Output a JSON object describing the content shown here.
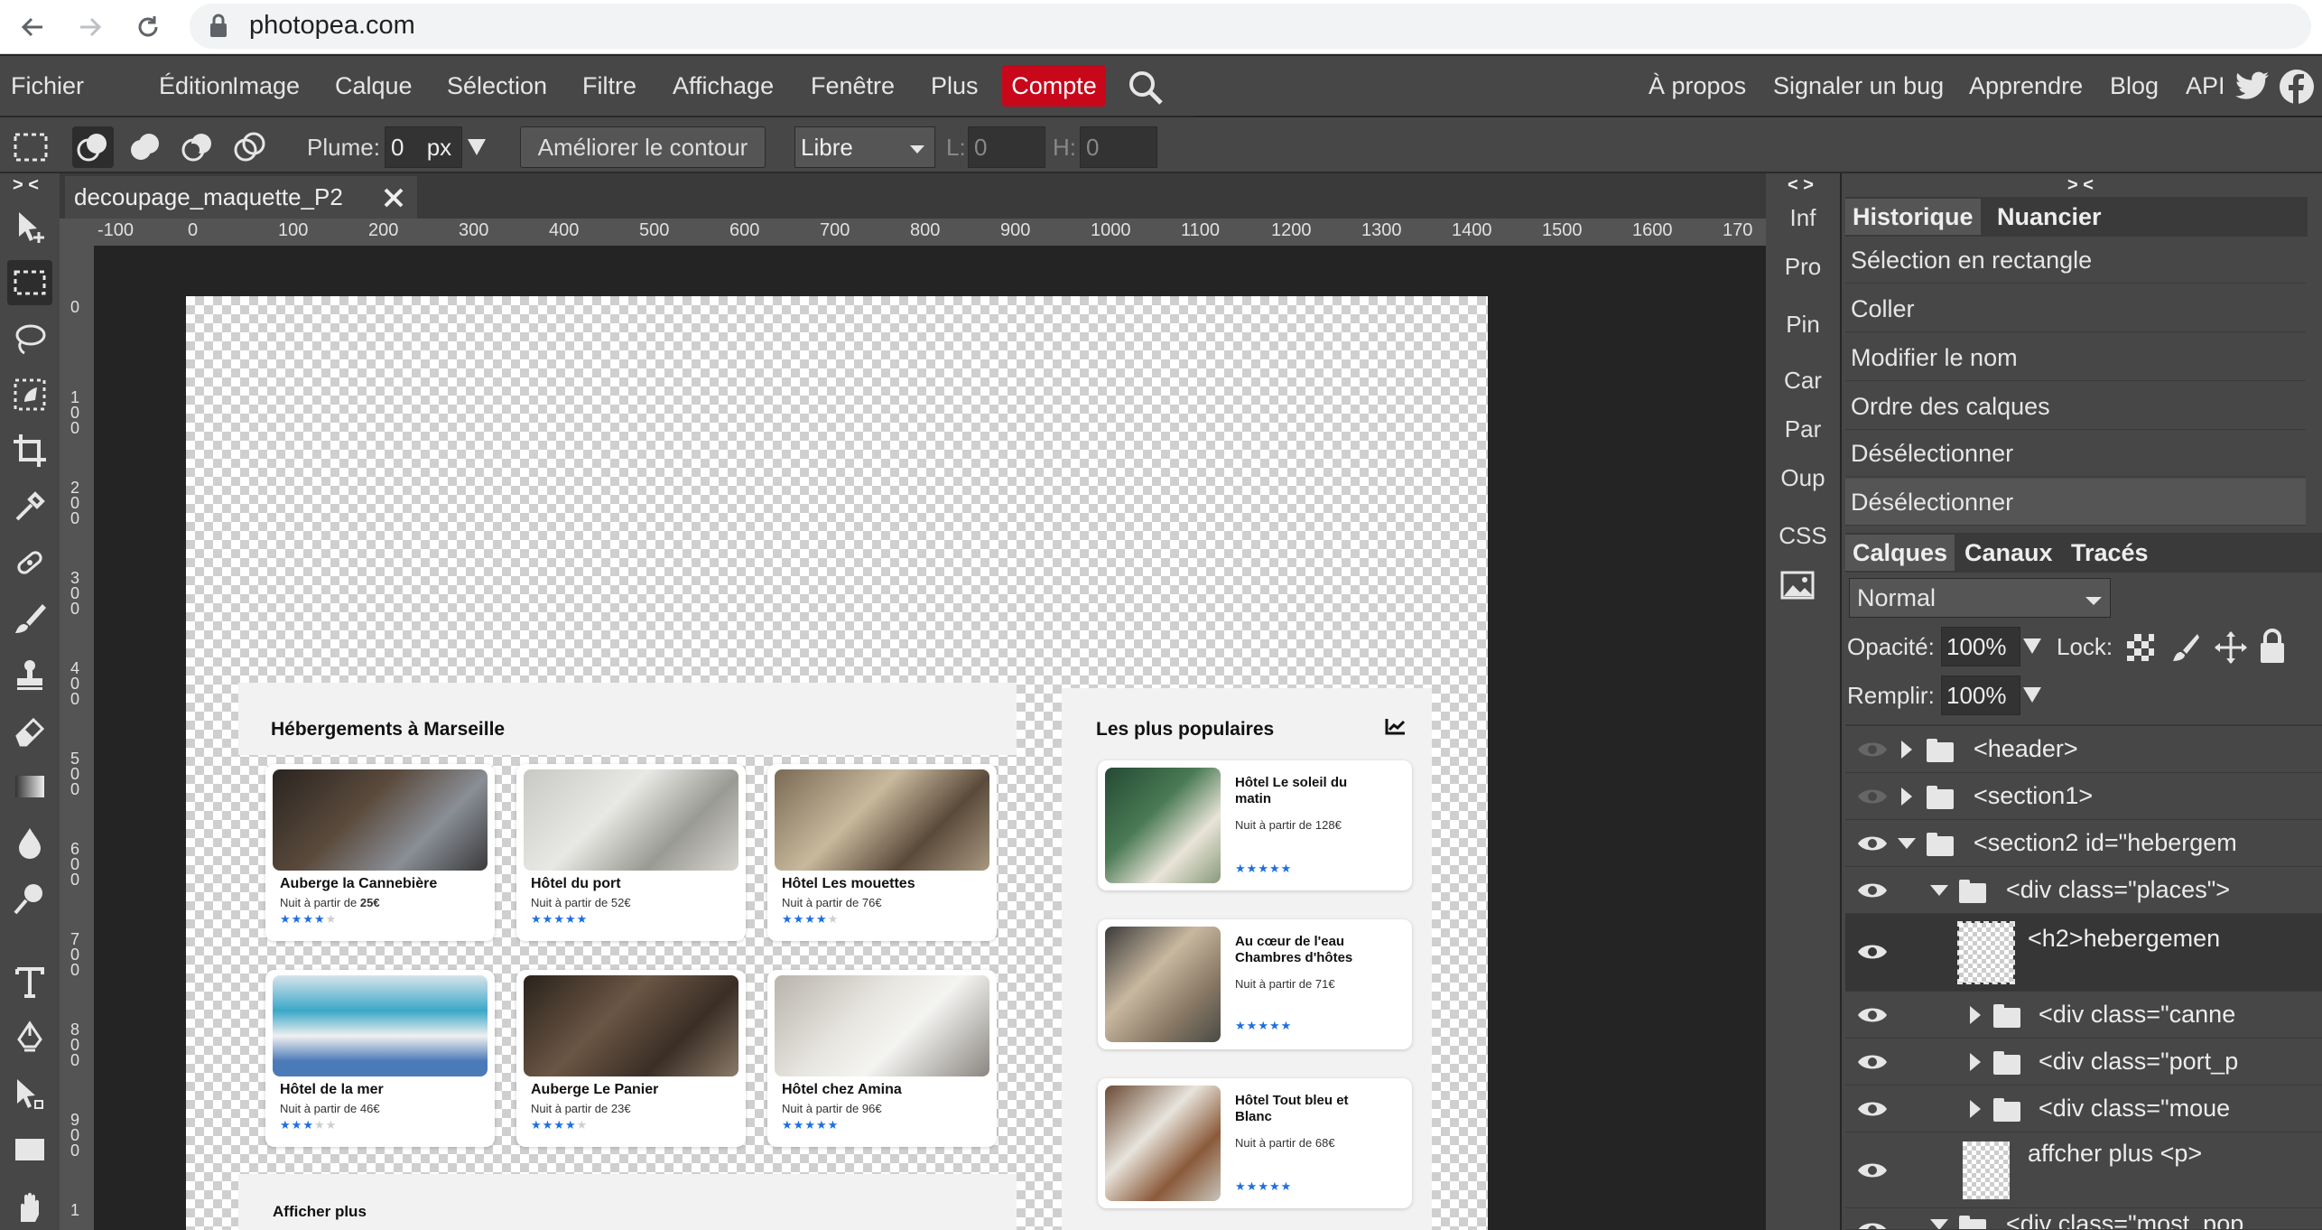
{
  "browser": {
    "url": "photopea.com"
  },
  "menubar": {
    "items": [
      "Fichier",
      "Édition",
      "Image",
      "Calque",
      "Sélection",
      "Filtre",
      "Affichage",
      "Fenêtre",
      "Plus"
    ],
    "account": "Compte",
    "right_links": [
      "À propos",
      "Signaler un bug",
      "Apprendre",
      "Blog",
      "API"
    ]
  },
  "options": {
    "plume_label": "Plume:",
    "plume_value": "0",
    "plume_unit": "px",
    "refine": "Améliorer le contour",
    "style": "Libre",
    "w_label": "L:",
    "w_value": "0",
    "h_label": "H:",
    "h_value": "0"
  },
  "collapse_left": "> <",
  "collapse_mid": "< >",
  "collapse_right": "> <",
  "doc": {
    "tab_title": "decoupage_maquette_P2",
    "ruler_h": [
      "-100",
      "0",
      "100",
      "200",
      "300",
      "400",
      "500",
      "600",
      "700",
      "800",
      "900",
      "1000",
      "1100",
      "1200",
      "1300",
      "1400",
      "1500",
      "1600",
      "170"
    ],
    "ruler_v": [
      "0",
      "100",
      "200",
      "300",
      "400",
      "500",
      "600",
      "700",
      "800",
      "900",
      "1"
    ]
  },
  "mockup": {
    "section_title": "Hébergements à Marseille",
    "popular_title": "Les plus populaires",
    "more": "Afficher plus",
    "hotels": [
      {
        "name": "Auberge la Cannebière",
        "price_prefix": "Nuit à partir de ",
        "price": "25€",
        "stars": 4,
        "price_bold": true
      },
      {
        "name": "Hôtel du port",
        "price_prefix": "Nuit à partir de ",
        "price": "52€",
        "stars": 5,
        "price_bold": false
      },
      {
        "name": "Hôtel Les mouettes",
        "price_prefix": "Nuit à partir de ",
        "price": "76€",
        "stars": 4,
        "price_bold": false
      },
      {
        "name": "Hôtel de la mer",
        "price_prefix": "Nuit à partir de ",
        "price": "46€",
        "stars": 3,
        "price_bold": false
      },
      {
        "name": "Auberge Le Panier",
        "price_prefix": "Nuit à partir de ",
        "price": "23€",
        "stars": 4,
        "price_bold": false
      },
      {
        "name": "Hôtel chez Amina",
        "price_prefix": "Nuit à partir de ",
        "price": "96€",
        "stars": 5,
        "price_bold": false
      }
    ],
    "popular": [
      {
        "name": "Hôtel Le soleil du matin",
        "price": "Nuit à partir de 128€",
        "stars": 5
      },
      {
        "name": "Au cœur de l'eau Chambres d'hôtes",
        "price": "Nuit à partir de 71€",
        "stars": 4
      },
      {
        "name": "Hôtel Tout bleu et Blanc",
        "price": "Nuit à partir de 68€",
        "stars": 4
      }
    ],
    "star_char": "★"
  },
  "mini_panel": [
    "Inf",
    "Pro",
    "Pin",
    "Car",
    "Par",
    "Oup",
    "CSS"
  ],
  "history": {
    "tabs": [
      "Historique",
      "Nuancier"
    ],
    "items": [
      "Sélection en rectangle",
      "Coller",
      "Modifier le nom",
      "Ordre des calques",
      "Désélectionner",
      "Désélectionner"
    ]
  },
  "layers": {
    "tabs": [
      "Calques",
      "Canaux",
      "Tracés"
    ],
    "blend_mode": "Normal",
    "opacity_label": "Opacité:",
    "opacity": "100%",
    "lock_label": "Lock:",
    "fill_label": "Remplir:",
    "fill": "100%",
    "rows": [
      {
        "name": "<header>",
        "type": "folder",
        "expanded": false,
        "visible": false
      },
      {
        "name": "<section1>",
        "type": "folder",
        "expanded": false,
        "visible": false
      },
      {
        "name": "<section2 id=\"hebergem",
        "type": "folder",
        "expanded": true,
        "visible": true
      },
      {
        "name": "<div class=\"places\">",
        "type": "folder",
        "expanded": true,
        "visible": true
      },
      {
        "name": "<h2>hebergemen",
        "type": "layer",
        "visible": true,
        "selected": true
      },
      {
        "name": "<div class=\"canne",
        "type": "folder",
        "expanded": false,
        "visible": true
      },
      {
        "name": "<div class=\"port_p",
        "type": "folder",
        "expanded": false,
        "visible": true
      },
      {
        "name": "<div class=\"moue",
        "type": "folder",
        "expanded": false,
        "visible": true
      },
      {
        "name": "affcher plus <p>",
        "type": "layer",
        "visible": true
      },
      {
        "name": "<div class=\"most_pop",
        "type": "folder",
        "expanded": true,
        "visible": true
      }
    ]
  }
}
